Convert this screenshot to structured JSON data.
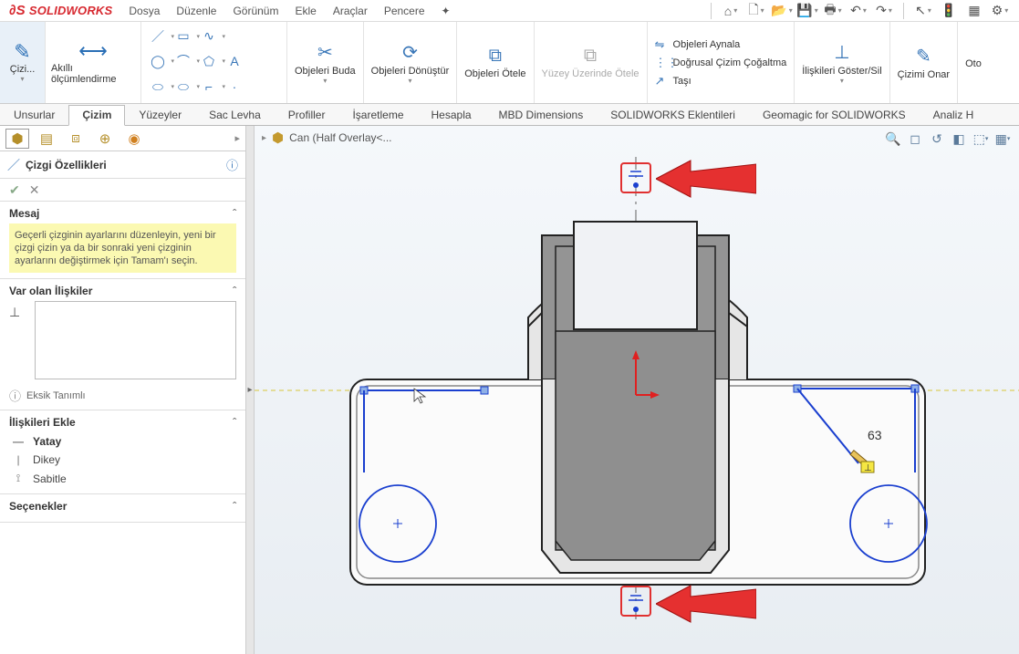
{
  "app": {
    "name": "SOLIDWORKS"
  },
  "menus": [
    "Dosya",
    "Düzenle",
    "Görünüm",
    "Ekle",
    "Araçlar",
    "Pencere"
  ],
  "ribbon": {
    "sketch_tool": "Çizi...",
    "dimension_tool": "Akıllı ölçümlendirme",
    "trim": "Objeleri Buda",
    "convert": "Objeleri Dönüştür",
    "offset": "Objeleri Ötele",
    "surface_offset": "Yüzey Üzerinde Ötele",
    "mirror": "Objeleri Aynala",
    "linear_pattern": "Doğrusal Çizim Çoğaltma",
    "move": "Taşı",
    "show_relations": "İlişkileri Göster/Sil",
    "repair": "Çizimi Onar",
    "oto": "Oto"
  },
  "tabs": [
    "Unsurlar",
    "Çizim",
    "Yüzeyler",
    "Sac Levha",
    "Profiller",
    "İşaretleme",
    "Hesapla",
    "MBD Dimensions",
    "SOLIDWORKS Eklentileri",
    "Geomagic for SOLIDWORKS",
    "Analiz H"
  ],
  "active_tab": "Çizim",
  "breadcrumb": {
    "model": "Can  (Half Overlay<..."
  },
  "property_panel": {
    "title": "Çizgi Özellikleri",
    "sections": {
      "message": {
        "head": "Mesaj",
        "body": "Geçerli çizginin ayarlarını düzenleyin, yeni bir çizgi çizin ya da bir sonraki yeni çizginin ayarlarını değiştirmek için Tamam'ı seçin."
      },
      "existing": {
        "head": "Var olan İlişkiler"
      },
      "info": {
        "text": "Eksik Tanımlı"
      },
      "add": {
        "head": "İlişkileri Ekle",
        "items": [
          {
            "icon": "—",
            "label": "Yatay"
          },
          {
            "icon": "|",
            "label": "Dikey"
          },
          {
            "icon": "⟟",
            "label": "Sabitle"
          }
        ]
      },
      "options": {
        "head": "Seçenekler"
      }
    }
  },
  "viewport_annotation": {
    "dimension_value": "63"
  }
}
